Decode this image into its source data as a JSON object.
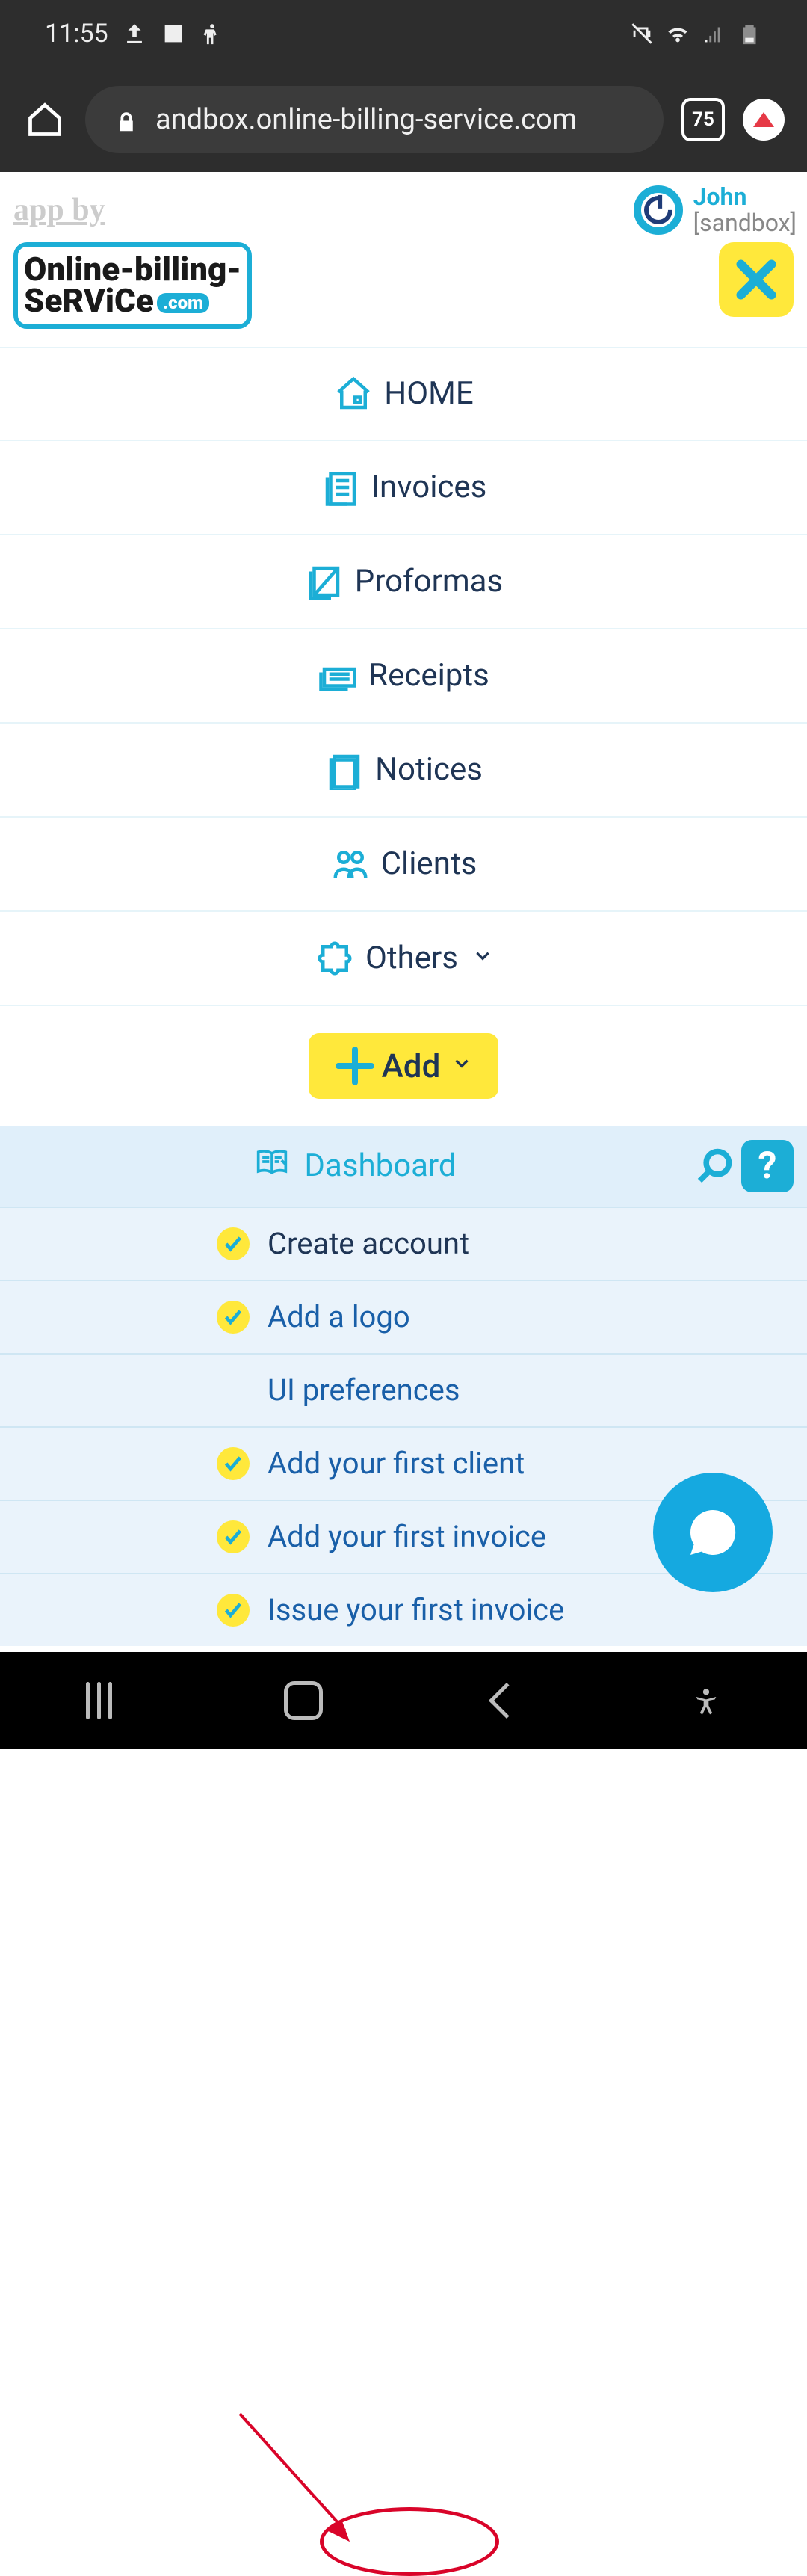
{
  "status": {
    "time": "11:55"
  },
  "browser": {
    "url": "andbox.online-billing-service.com",
    "tab_count": "75"
  },
  "header": {
    "app_by": "app by",
    "logo_line1": "Online-billing-",
    "logo_line2": "SeRViCe",
    "logo_com": ".com",
    "user_name": "John",
    "user_sub": "[sandbox]"
  },
  "nav": {
    "home": "HOME",
    "invoices": "Invoices",
    "proformas": "Proformas",
    "receipts": "Receipts",
    "notices": "Notices",
    "clients": "Clients",
    "others": "Others",
    "add": "Add"
  },
  "dashboard": {
    "title": "Dashboard",
    "help": "?"
  },
  "checklist": {
    "items": [
      {
        "label": "Create account",
        "done": true
      },
      {
        "label": "Add a logo",
        "done": true
      },
      {
        "label": "UI preferences",
        "done": false
      },
      {
        "label": "Add your first client",
        "done": true
      },
      {
        "label": "Add your first invoice",
        "done": true
      },
      {
        "label": "Issue your first invoice",
        "done": true
      }
    ]
  }
}
